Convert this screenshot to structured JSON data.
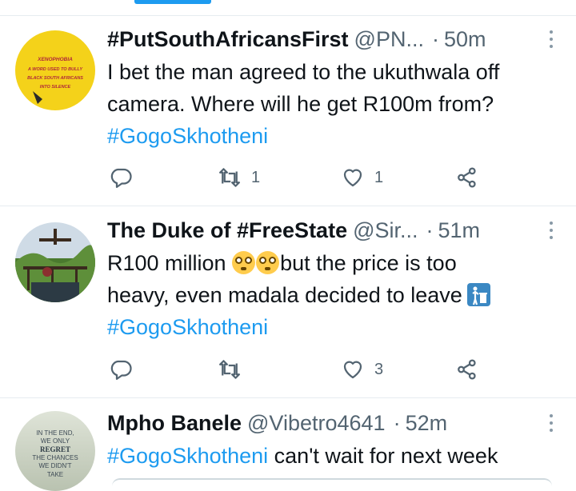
{
  "tweets": [
    {
      "name": "#PutSouthAfricansFirst",
      "handle": "@PN...",
      "time": "50m",
      "text_lines": [
        "I bet the man agreed to the ukuthwala off",
        "camera. Where will he get R100m from?"
      ],
      "hashtag": "#GogoSkhotheni",
      "avatar_text": [
        "XENOPHOBIA",
        "A WORD USED TO BULLY",
        "BLACK SOUTH AFRICANS",
        "INTO SILENCE"
      ],
      "retweets": "1",
      "likes": "1"
    },
    {
      "name": "The Duke of #FreeState",
      "handle": "@Sir...",
      "time": "51m",
      "text_line1_before": "R100 million ",
      "text_line1_after": "but the price is too",
      "text_line2": "heavy, even madala decided to leave",
      "hashtag": "#GogoSkhotheni",
      "retweets": "",
      "likes": "3"
    },
    {
      "name": "Mpho Banele",
      "handle": "@Vibetro4641",
      "time": "52m",
      "hashtag": "#GogoSkhotheni",
      "text_after_hashtag": " can't wait for next week",
      "avatar_text": [
        "IN THE END,",
        "WE ONLY",
        "REGRET",
        "THE CHANCES",
        "WE DIDN'T",
        "TAKE"
      ]
    }
  ],
  "icons": {
    "reply": "reply-icon",
    "retweet": "retweet-icon",
    "like": "heart-icon",
    "share": "share-icon",
    "more": "more-icon",
    "flushed_emoji": "flushed-face-emoji",
    "litter_emoji": "put-litter-in-its-place-emoji"
  },
  "colors": {
    "accent": "#1d9bf0",
    "text": "#0f1419",
    "muted": "#536471",
    "avatar1_bg": "#f4d21a"
  }
}
